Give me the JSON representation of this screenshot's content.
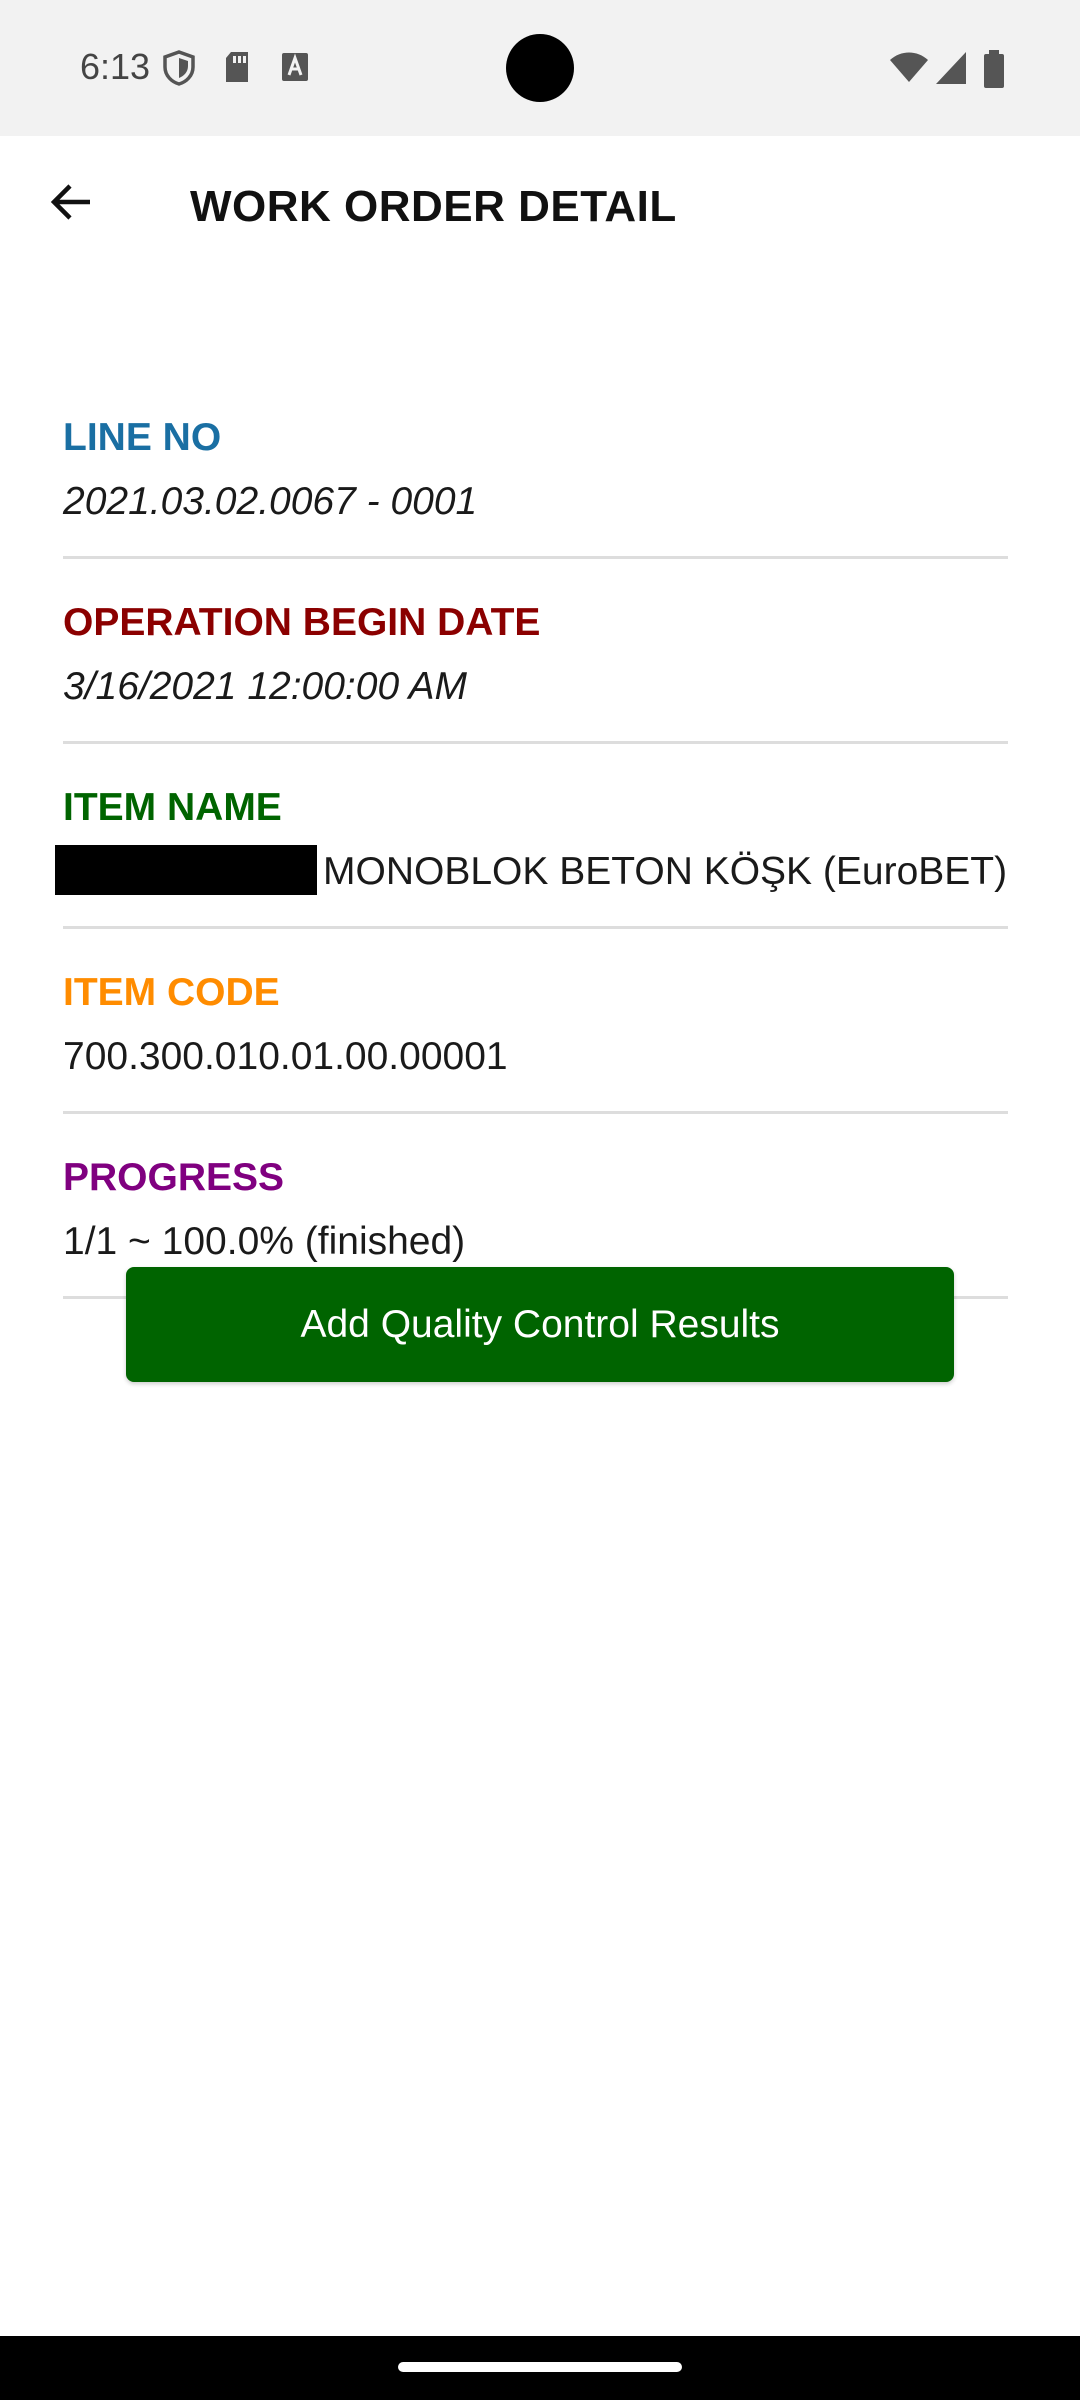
{
  "status_bar": {
    "time": "6:13",
    "icons_left": [
      "shield-icon",
      "sd-card-icon",
      "keyboard-a-icon"
    ],
    "icons_right": [
      "wifi-icon",
      "signal-icon",
      "battery-icon"
    ]
  },
  "app_bar": {
    "title": "WORK ORDER DETAIL",
    "back_icon": "arrow-back-icon"
  },
  "fields": {
    "line_no": {
      "label": "LINE NO",
      "value": "2021.03.02.0067 - 0001",
      "label_color": "#1A6FA3"
    },
    "operation_begin_date": {
      "label": "OPERATION BEGIN DATE",
      "value": "3/16/2021 12:00:00 AM",
      "label_color": "#8B0000"
    },
    "item_name": {
      "label": "ITEM NAME",
      "value": "MONOBLOK BETON KÖŞK (EuroBET)",
      "label_color": "#006400"
    },
    "item_code": {
      "label": "ITEM CODE",
      "value": "700.300.010.01.00.00001",
      "label_color": "#FF8C00"
    },
    "progress": {
      "label": "PROGRESS",
      "value": "1/1 ~ 100.0% (finished)",
      "label_color": "#800080"
    }
  },
  "actions": {
    "add_qc_label": "Add Quality Control Results",
    "button_color": "#006400"
  }
}
